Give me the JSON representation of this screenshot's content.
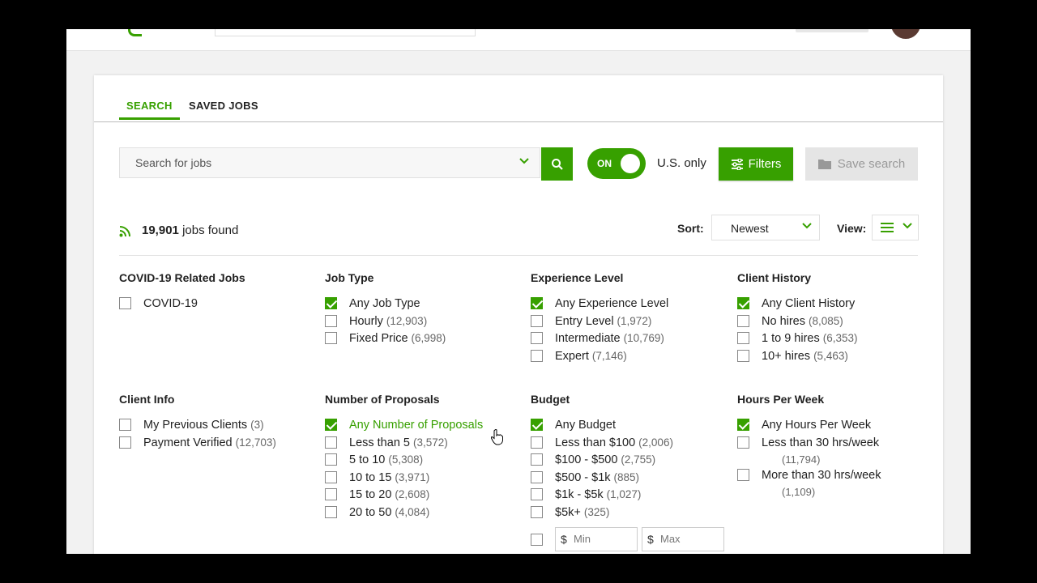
{
  "tabs": {
    "search": "SEARCH",
    "saved": "SAVED JOBS"
  },
  "search": {
    "placeholder": "Search for jobs"
  },
  "toggle": {
    "label": "ON",
    "state": "on"
  },
  "us_only": "U.S. only",
  "filters_label": "Filters",
  "save_search_label": "Save search",
  "results": {
    "count": "19,901",
    "suffix": "jobs found"
  },
  "sort": {
    "label": "Sort:",
    "value": "Newest"
  },
  "view": {
    "label": "View:"
  },
  "colors": {
    "accent": "#37a000",
    "disabled_bg": "#e5e5e5"
  },
  "filters": {
    "covid": {
      "title": "COVID-19 Related Jobs",
      "options": [
        {
          "label": "COVID-19",
          "count": "",
          "checked": false
        }
      ]
    },
    "job_type": {
      "title": "Job Type",
      "options": [
        {
          "label": "Any Job Type",
          "count": "",
          "checked": true
        },
        {
          "label": "Hourly",
          "count": "(12,903)",
          "checked": false
        },
        {
          "label": "Fixed Price",
          "count": "(6,998)",
          "checked": false
        }
      ]
    },
    "experience": {
      "title": "Experience Level",
      "options": [
        {
          "label": "Any Experience Level",
          "count": "",
          "checked": true
        },
        {
          "label": "Entry Level",
          "count": "(1,972)",
          "checked": false
        },
        {
          "label": "Intermediate",
          "count": "(10,769)",
          "checked": false
        },
        {
          "label": "Expert",
          "count": "(7,146)",
          "checked": false
        }
      ]
    },
    "client_history": {
      "title": "Client History",
      "options": [
        {
          "label": "Any Client History",
          "count": "",
          "checked": true
        },
        {
          "label": "No hires",
          "count": "(8,085)",
          "checked": false
        },
        {
          "label": "1 to 9 hires",
          "count": "(6,353)",
          "checked": false
        },
        {
          "label": "10+ hires",
          "count": "(5,463)",
          "checked": false
        }
      ]
    },
    "client_info": {
      "title": "Client Info",
      "options": [
        {
          "label": "My Previous Clients",
          "count": "(3)",
          "checked": false
        },
        {
          "label": "Payment Verified",
          "count": "(12,703)",
          "checked": false
        }
      ]
    },
    "proposals": {
      "title": "Number of Proposals",
      "options": [
        {
          "label": "Any Number of Proposals",
          "count": "",
          "checked": true
        },
        {
          "label": "Less than 5",
          "count": "(3,572)",
          "checked": false
        },
        {
          "label": "5 to 10",
          "count": "(5,308)",
          "checked": false
        },
        {
          "label": "10 to 15",
          "count": "(3,971)",
          "checked": false
        },
        {
          "label": "15 to 20",
          "count": "(2,608)",
          "checked": false
        },
        {
          "label": "20 to 50",
          "count": "(4,084)",
          "checked": false
        }
      ]
    },
    "budget": {
      "title": "Budget",
      "options": [
        {
          "label": "Any Budget",
          "count": "",
          "checked": true
        },
        {
          "label": "Less than $100",
          "count": "(2,006)",
          "checked": false
        },
        {
          "label": "$100 - $500",
          "count": "(2,755)",
          "checked": false
        },
        {
          "label": "$500 - $1k",
          "count": "(885)",
          "checked": false
        },
        {
          "label": "$1k - $5k",
          "count": "(1,027)",
          "checked": false
        },
        {
          "label": "$5k+",
          "count": "(325)",
          "checked": false
        }
      ],
      "min_placeholder": "Min",
      "max_placeholder": "Max",
      "currency": "$"
    },
    "hours": {
      "title": "Hours Per Week",
      "options": [
        {
          "label": "Any Hours Per Week",
          "count": "",
          "checked": true
        },
        {
          "label": "Less than 30 hrs/week",
          "count": "(11,794)",
          "checked": false
        },
        {
          "label": "More than 30 hrs/week",
          "count": "(1,109)",
          "checked": false
        }
      ]
    }
  }
}
